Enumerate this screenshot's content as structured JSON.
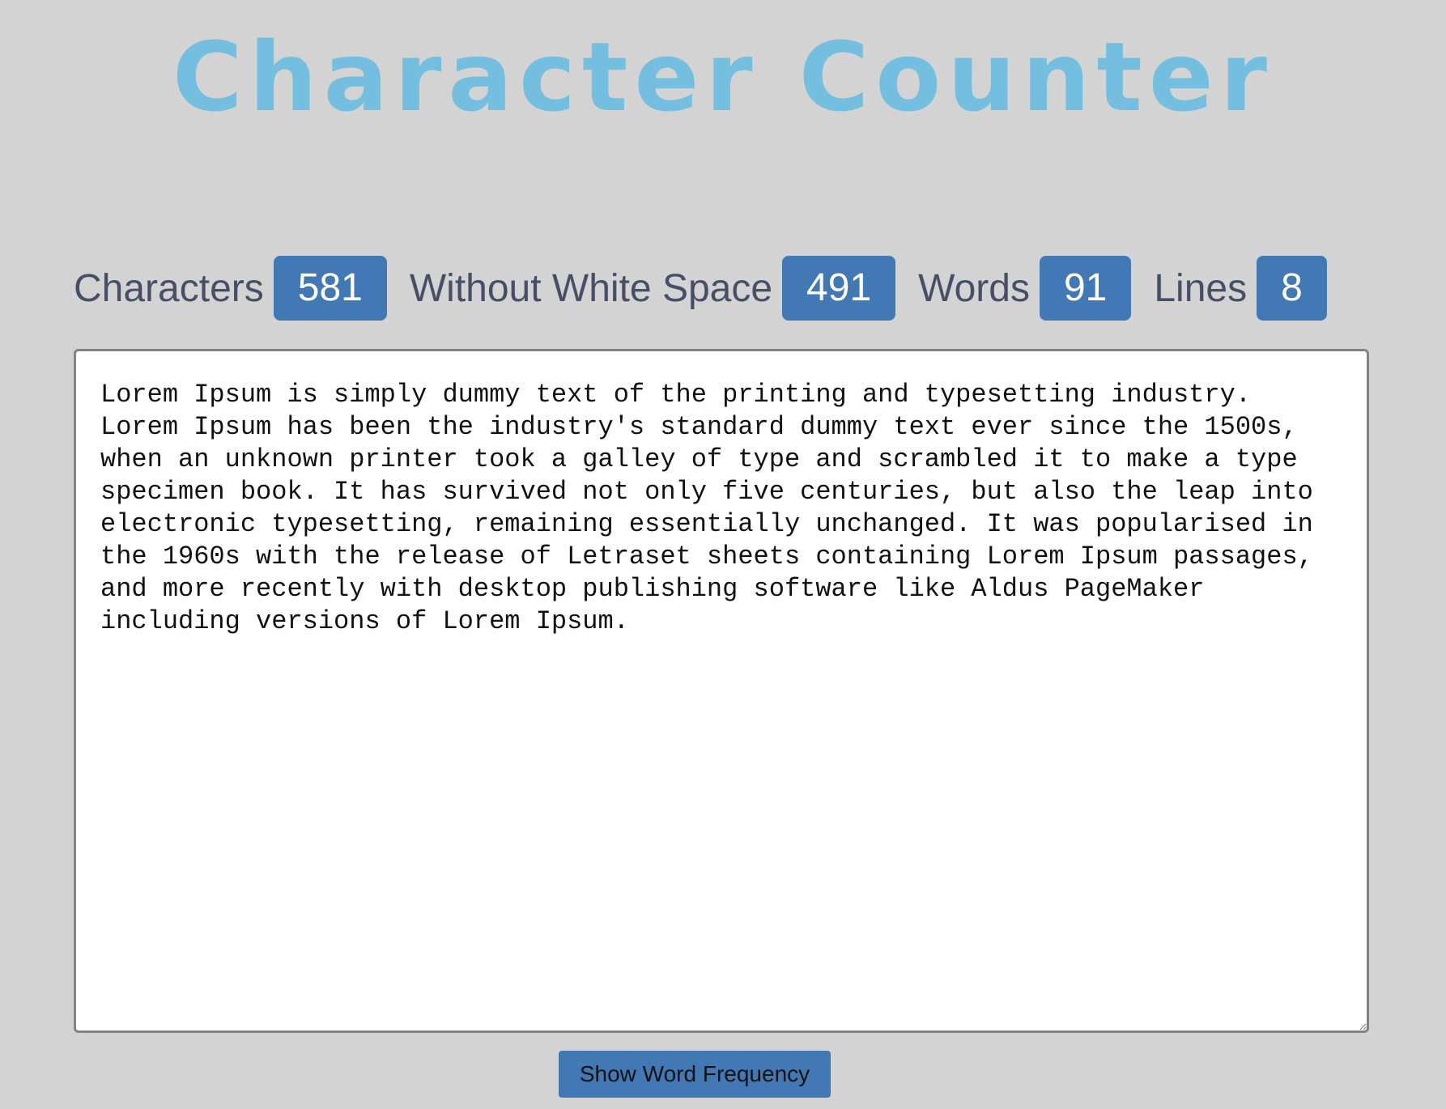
{
  "title": "Character Counter",
  "stats": [
    {
      "label": "Characters",
      "value": "581"
    },
    {
      "label": "Without White Space",
      "value": "491"
    },
    {
      "label": "Words",
      "value": "91"
    },
    {
      "label": "Lines",
      "value": "8"
    }
  ],
  "editor": {
    "text": "Lorem Ipsum is simply dummy text of the printing and typesetting industry.\nLorem Ipsum has been the industry's standard dummy text ever since the 1500s,\nwhen an unknown printer took a galley of type and scrambled it to make a type\nspecimen book. It has survived not only five centuries, but also the leap into\nelectronic typesetting, remaining essentially unchanged. It was popularised in\nthe 1960s with the release of Letraset sheets containing Lorem Ipsum passages,\nand more recently with desktop publishing software like Aldus PageMaker\nincluding versions of Lorem Ipsum."
  },
  "button": {
    "label": "Show Word Frequency"
  },
  "colors": {
    "background": "#d3d3d3",
    "title": "#74bfdf",
    "accent": "#4279b4",
    "label_text": "#474f66"
  },
  "icons": {
    "resize": "resize-grip-icon"
  }
}
